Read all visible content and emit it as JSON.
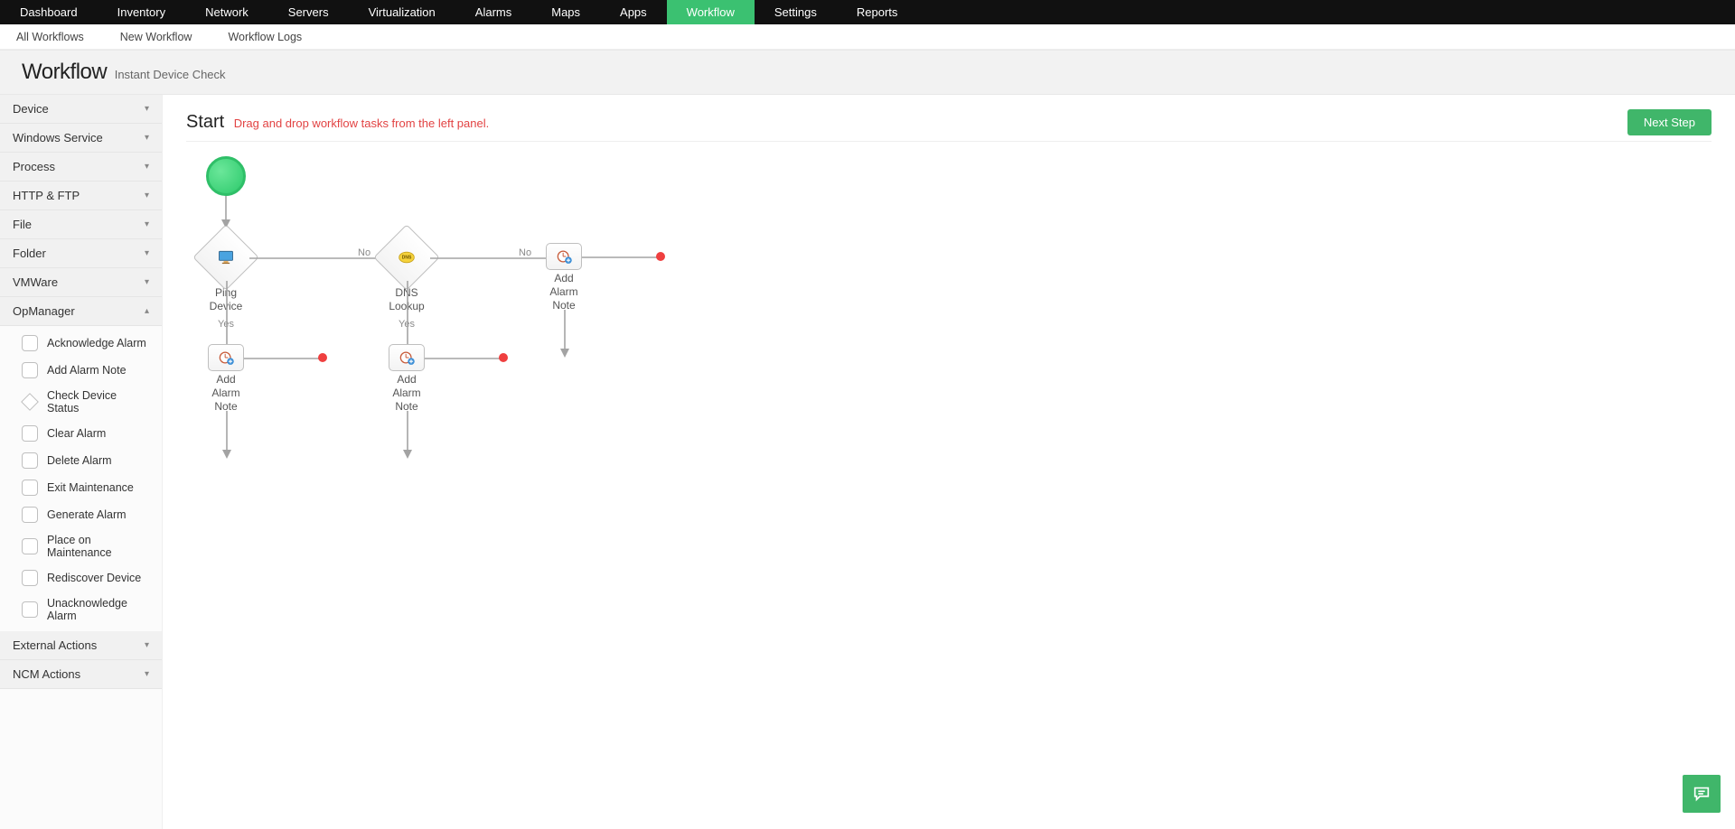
{
  "topnav": {
    "items": [
      "Dashboard",
      "Inventory",
      "Network",
      "Servers",
      "Virtualization",
      "Alarms",
      "Maps",
      "Apps",
      "Workflow",
      "Settings",
      "Reports"
    ],
    "active": "Workflow"
  },
  "subnav": {
    "items": [
      "All Workflows",
      "New Workflow",
      "Workflow Logs"
    ]
  },
  "title": {
    "main": "Workflow",
    "sub": "Instant Device Check"
  },
  "canvas_header": {
    "label": "Start",
    "hint": "Drag and drop workflow tasks from the left panel.",
    "next": "Next Step"
  },
  "accordion": {
    "groups": [
      {
        "label": "Device",
        "open": false,
        "items": []
      },
      {
        "label": "Windows Service",
        "open": false,
        "items": []
      },
      {
        "label": "Process",
        "open": false,
        "items": []
      },
      {
        "label": "HTTP & FTP",
        "open": false,
        "items": []
      },
      {
        "label": "File",
        "open": false,
        "items": []
      },
      {
        "label": "Folder",
        "open": false,
        "items": []
      },
      {
        "label": "VMWare",
        "open": false,
        "items": []
      },
      {
        "label": "OpManager",
        "open": true,
        "items": [
          {
            "label": "Acknowledge Alarm",
            "shape": "rounded"
          },
          {
            "label": "Add Alarm Note",
            "shape": "rounded"
          },
          {
            "label": "Check Device Status",
            "shape": "diamond"
          },
          {
            "label": "Clear Alarm",
            "shape": "rounded"
          },
          {
            "label": "Delete Alarm",
            "shape": "rounded"
          },
          {
            "label": "Exit Maintenance",
            "shape": "rounded"
          },
          {
            "label": "Generate Alarm",
            "shape": "rounded"
          },
          {
            "label": "Place on Maintenance",
            "shape": "rounded"
          },
          {
            "label": "Rediscover Device",
            "shape": "rounded"
          },
          {
            "label": "Unacknowledge Alarm",
            "shape": "rounded"
          }
        ]
      },
      {
        "label": "External Actions",
        "open": false,
        "items": []
      },
      {
        "label": "NCM Actions",
        "open": false,
        "items": []
      }
    ]
  },
  "nodes": {
    "ping": {
      "label": "Ping\nDevice"
    },
    "dns": {
      "label": "DNS\nLookup"
    },
    "alarm1": {
      "label": "Add\nAlarm\nNote"
    },
    "alarm2": {
      "label": "Add\nAlarm\nNote"
    },
    "alarm3": {
      "label": "Add\nAlarm\nNote"
    }
  },
  "edges": {
    "yes": "Yes",
    "no": "No"
  }
}
